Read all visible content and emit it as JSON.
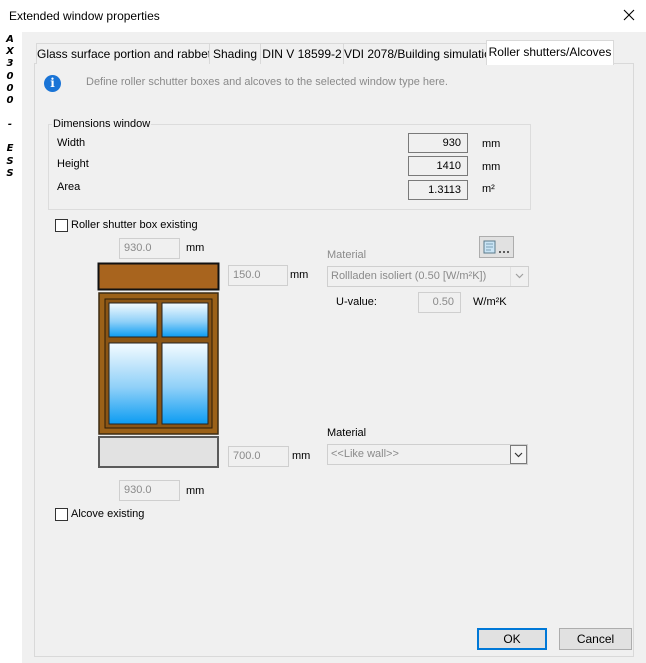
{
  "window": {
    "title": "Extended window properties",
    "close_icon": "close-icon",
    "side_label": [
      "A",
      "X",
      "3",
      "0",
      "0",
      "0",
      "",
      "-",
      "",
      "E",
      "S",
      "S"
    ]
  },
  "tabs": [
    {
      "label": "Glass surface portion and rabbets",
      "active": false
    },
    {
      "label": "Shading",
      "active": false
    },
    {
      "label": "DIN V 18599-2",
      "active": false
    },
    {
      "label": "VDI 2078/Building simulation",
      "active": false
    },
    {
      "label": "Roller shutters/Alcoves",
      "active": true
    }
  ],
  "info": {
    "icon": "info-icon",
    "text": "Define roller schutter boxes and alcoves to the selected window type here."
  },
  "dimensions": {
    "title": "Dimensions window",
    "width_label": "Width",
    "width_value": "930",
    "width_unit": "mm",
    "height_label": "Height",
    "height_value": "1410",
    "height_unit": "mm",
    "area_label": "Area",
    "area_value": "1.3113",
    "area_unit": "m²"
  },
  "roller_shutter": {
    "checkbox_label": "Roller shutter box existing",
    "checked": false,
    "top_width_value": "930.0",
    "top_width_unit": "mm",
    "box_height_value": "150.0",
    "box_height_unit": "mm",
    "material_label": "Material",
    "material_value": "Rollladen isoliert (0.50 [W/m²K])",
    "uvalue_label": "U-value:",
    "uvalue_value": "0.50",
    "uvalue_unit": "W/m²K",
    "catalog_button_label": "..."
  },
  "alcove_section": {
    "height_value": "700.0",
    "height_unit": "mm",
    "material_label": "Material",
    "material_value": "<<Like wall>>",
    "bottom_width_value": "930.0",
    "bottom_width_unit": "mm"
  },
  "alcove": {
    "checkbox_label": "Alcove existing",
    "checked": false
  },
  "buttons": {
    "ok": "OK",
    "cancel": "Cancel"
  },
  "colors": {
    "frame_wood": "#9b6118",
    "box_fill": "#a8641e",
    "glass_top": "#f4fbff",
    "glass_bottom": "#0c9cf2",
    "accent": "#0078d7"
  }
}
